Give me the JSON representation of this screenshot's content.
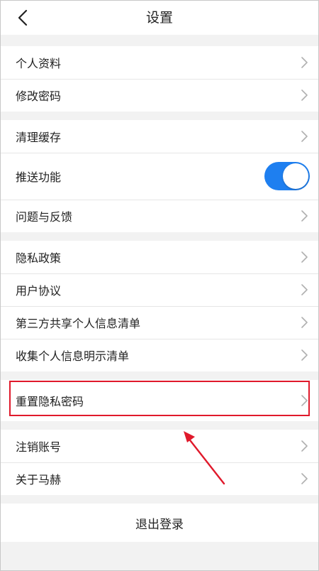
{
  "header": {
    "title": "设置",
    "back_icon": "chevron-left-icon"
  },
  "groups": [
    {
      "items": [
        {
          "label": "个人资料"
        },
        {
          "label": "修改密码"
        }
      ]
    },
    {
      "items": [
        {
          "label": "清理缓存"
        },
        {
          "label": "推送功能",
          "toggle": true
        },
        {
          "label": "问题与反馈"
        }
      ]
    },
    {
      "items": [
        {
          "label": "隐私政策"
        },
        {
          "label": "用户协议"
        },
        {
          "label": "第三方共享个人信息清单"
        },
        {
          "label": "收集个人信息明示清单"
        }
      ]
    },
    {
      "items": [
        {
          "label": "重置隐私密码",
          "highlighted": true
        }
      ]
    },
    {
      "items": [
        {
          "label": "注销账号"
        },
        {
          "label": "关于马赫"
        }
      ]
    }
  ],
  "logout_label": "退出登录",
  "colors": {
    "toggle_on": "#1e7ff0",
    "annotation": "#e0192b",
    "background": "#f2f2f2"
  }
}
